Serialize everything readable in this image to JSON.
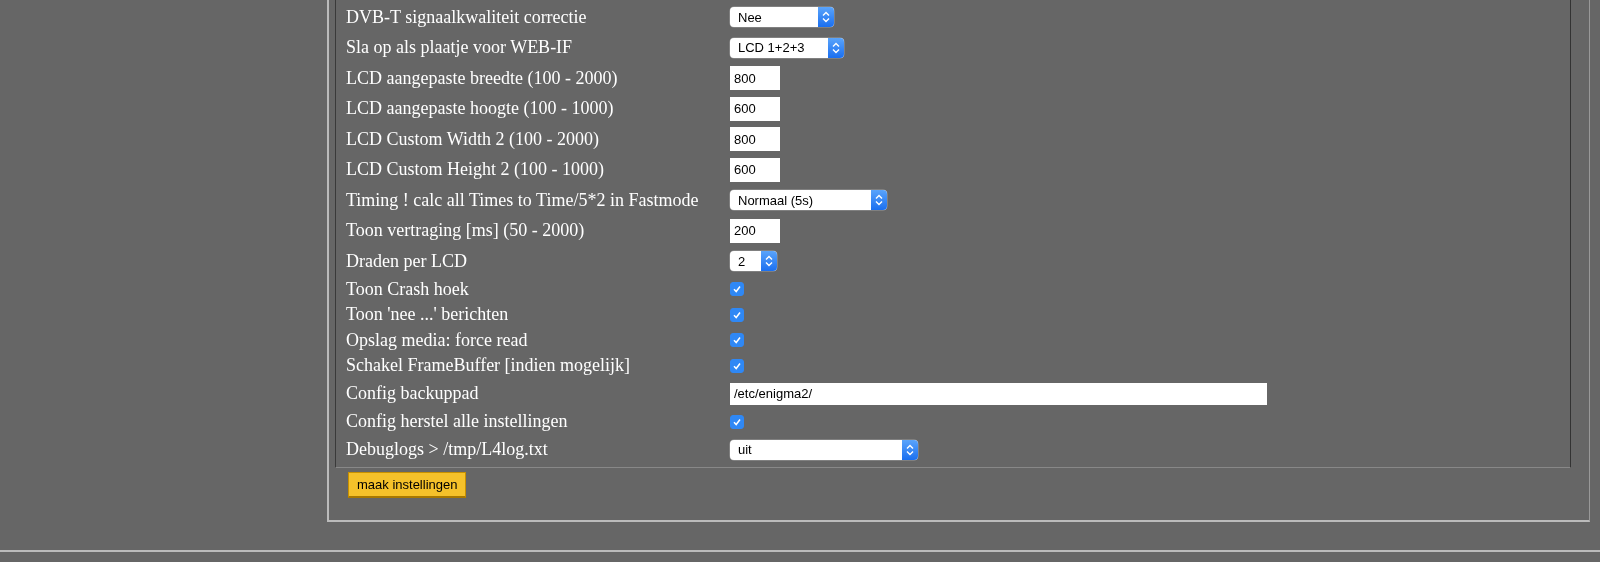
{
  "settings": [
    {
      "label": "DVB-T signaalkwaliteit correctie",
      "kind": "select",
      "value": "Nee"
    },
    {
      "label": "Sla op als plaatje voor WEB-IF",
      "kind": "select",
      "value": "LCD 1+2+3"
    },
    {
      "label": "LCD aangepaste breedte (100 - 2000)",
      "kind": "number",
      "value": "800"
    },
    {
      "label": "LCD aangepaste hoogte (100 - 1000)",
      "kind": "number",
      "value": "600"
    },
    {
      "label": "LCD Custom Width 2 (100 - 2000)",
      "kind": "number",
      "value": "800"
    },
    {
      "label": "LCD Custom Height 2 (100 - 1000)",
      "kind": "number",
      "value": "600"
    },
    {
      "label": "Timing ! calc all Times to Time/5*2 in Fastmode",
      "kind": "select",
      "value": "Normaal (5s)"
    },
    {
      "label": "Toon vertraging [ms] (50 - 2000)",
      "kind": "number",
      "value": "200"
    },
    {
      "label": "Draden per LCD",
      "kind": "select",
      "value": "2"
    },
    {
      "label": "Toon Crash hoek",
      "kind": "checkbox",
      "checked": true
    },
    {
      "label": "Toon 'nee ...' berichten",
      "kind": "checkbox",
      "checked": true
    },
    {
      "label": "Opslag media: force read",
      "kind": "checkbox",
      "checked": true
    },
    {
      "label": "Schakel FrameBuffer [indien mogelijk]",
      "kind": "checkbox",
      "checked": true
    },
    {
      "label": "Config backuppad",
      "kind": "text",
      "value": "/etc/enigma2/"
    },
    {
      "label": "Config herstel alle instellingen",
      "kind": "checkbox",
      "checked": true
    },
    {
      "label": "Debuglogs > /tmp/L4log.txt",
      "kind": "select",
      "value": "uit"
    }
  ],
  "submit_button": "maak instellingen"
}
